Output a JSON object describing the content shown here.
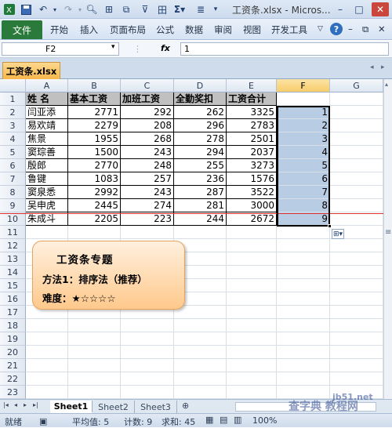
{
  "window": {
    "title": "工资条.xlsx - Micros..."
  },
  "ribbon": {
    "file_tab": "文件",
    "tabs": [
      "开始",
      "插入",
      "页面布局",
      "公式",
      "数据",
      "审阅",
      "视图",
      "开发工具"
    ]
  },
  "formula_bar": {
    "name_box": "F2",
    "fx": "fx",
    "value": "1"
  },
  "workbook_tab": "工资条.xlsx",
  "columns": [
    "A",
    "B",
    "C",
    "D",
    "E",
    "F",
    "G"
  ],
  "rows": [
    "1",
    "2",
    "3",
    "4",
    "5",
    "6",
    "7",
    "8",
    "9",
    "10",
    "11",
    "12",
    "13",
    "14",
    "15",
    "16",
    "17",
    "18",
    "19",
    "20",
    "21",
    "22",
    "23"
  ],
  "table": {
    "headers": [
      "姓 名",
      "基本工资",
      "加班工资",
      "全勤奖扣",
      "工资合计"
    ],
    "data": [
      [
        "闫亚添",
        "2771",
        "292",
        "262",
        "3325",
        "1"
      ],
      [
        "易欢靖",
        "2279",
        "208",
        "296",
        "2783",
        "2"
      ],
      [
        "焦景",
        "1955",
        "268",
        "278",
        "2501",
        "3"
      ],
      [
        "窦琮善",
        "1500",
        "243",
        "294",
        "2037",
        "4"
      ],
      [
        "殷郎",
        "2770",
        "248",
        "255",
        "3273",
        "5"
      ],
      [
        "鲁键",
        "1083",
        "257",
        "236",
        "1576",
        "6"
      ],
      [
        "窦泉悉",
        "2992",
        "243",
        "287",
        "3522",
        "7"
      ],
      [
        "吴申虎",
        "2445",
        "274",
        "281",
        "3000",
        "8"
      ],
      [
        "朱成斗",
        "2205",
        "223",
        "244",
        "2672",
        "9"
      ]
    ]
  },
  "note": {
    "title": "工资条专题",
    "method": "方法1：排序法（推荐）",
    "difficulty": "难度：★☆☆☆☆"
  },
  "sheets": [
    "Sheet1",
    "Sheet2",
    "Sheet3"
  ],
  "status": {
    "mode": "就绪",
    "average": "平均值: 5",
    "count": "计数: 9",
    "sum": "求和: 45",
    "zoom": "100%"
  },
  "watermark": {
    "line1": "查字典 教程网",
    "line2": "jb51.net"
  },
  "colors": {
    "file_tab": "#2a7a3b",
    "selection_fill": "#b8cce4",
    "header_fill": "#c0c0c0",
    "note_fill": "#ffc98c",
    "workbook_tab": "#f7b64a"
  }
}
